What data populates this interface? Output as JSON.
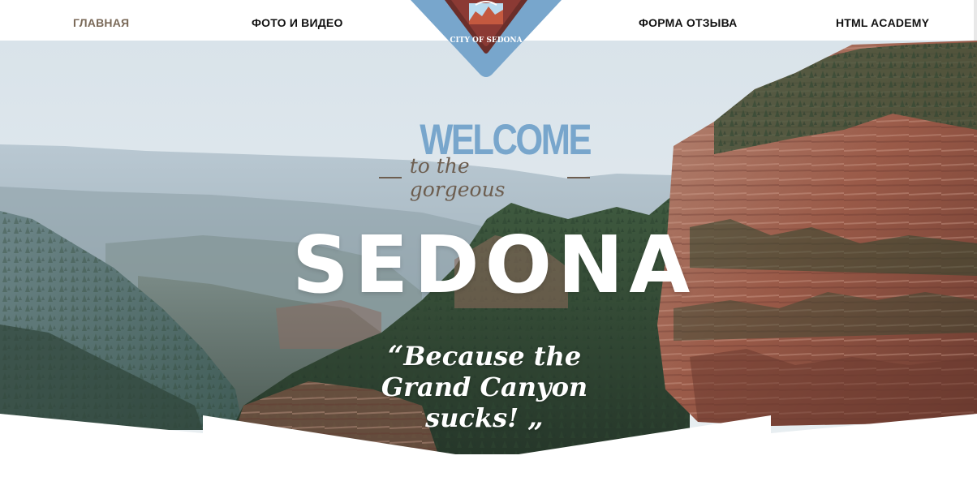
{
  "nav": {
    "items": [
      {
        "label": "ГЛАВНАЯ",
        "active": true
      },
      {
        "label": "ФОТО И ВИДЕО",
        "active": false
      },
      {
        "label": "ФОРМА ОТЗЫВА",
        "active": false
      },
      {
        "label": "HTML ACADEMY",
        "active": false
      }
    ]
  },
  "logo": {
    "text": "CITY OF SEDONA"
  },
  "hero": {
    "welcome": "WELCOME",
    "subtitle": "to the gorgeous",
    "title": "SEDONA",
    "quote_open": "“",
    "quote_text": "Because the Grand Canyon sucks!",
    "quote_close": "„"
  },
  "colors": {
    "accent": "#78a6cc",
    "brown": "#6d5e50",
    "active_nav": "#7a6958"
  }
}
